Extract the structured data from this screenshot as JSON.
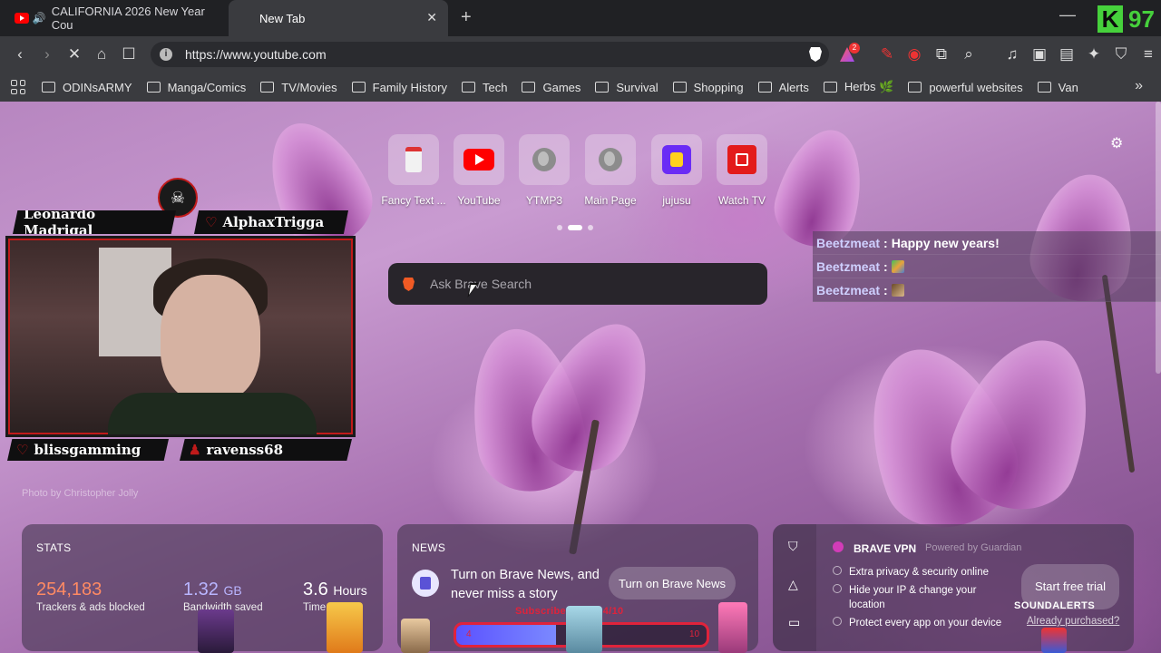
{
  "tabs": [
    {
      "title": "CALIFORNIA 2026 New Year Cou"
    },
    {
      "title": "New Tab"
    }
  ],
  "overlay_logo": {
    "letter": "K",
    "number": "97"
  },
  "address_bar": {
    "url": "https://www.youtube.com",
    "rewards_badge": "2"
  },
  "bookmarks": [
    {
      "label": "ODINsARMY"
    },
    {
      "label": "Manga/Comics"
    },
    {
      "label": "TV/Movies"
    },
    {
      "label": "Family History"
    },
    {
      "label": "Tech"
    },
    {
      "label": "Games"
    },
    {
      "label": "Survival"
    },
    {
      "label": "Shopping"
    },
    {
      "label": "Alerts"
    },
    {
      "label": "Herbs 🌿"
    },
    {
      "label": "powerful websites"
    },
    {
      "label": "Van"
    }
  ],
  "top_sites": [
    {
      "label": "Fancy Text ...",
      "icon": "document-icon"
    },
    {
      "label": "YouTube",
      "icon": "youtube-icon"
    },
    {
      "label": "YTMP3",
      "icon": "globe-icon"
    },
    {
      "label": "Main Page",
      "icon": "globe-icon"
    },
    {
      "label": "jujusu",
      "icon": "jujusu-icon"
    },
    {
      "label": "Watch TV",
      "icon": "tv-icon"
    }
  ],
  "search": {
    "placeholder": "Ask Brave Search"
  },
  "chat": [
    {
      "user": "Beetzmeat",
      "sep": ":",
      "message": "Happy new years!"
    },
    {
      "user": "Beetzmeat",
      "sep": ":",
      "message": ""
    },
    {
      "user": "Beetzmeat",
      "sep": ":",
      "message": ""
    }
  ],
  "stream_overlay": {
    "top_left_name": "Leonardo Madrigal",
    "top_right_name": "AlphaxTrigga",
    "bottom_left_name": "blissgamming",
    "bottom_right_name": "ravenss68",
    "photo_credit": "Photo by Christopher Jolly"
  },
  "stats": {
    "title": "STATS",
    "trackers_value": "254,183",
    "trackers_label": "Trackers & ads blocked",
    "bandwidth_value": "1.32",
    "bandwidth_unit": "GB",
    "bandwidth_label": "Bandwidth saved",
    "time_value": "3.6",
    "time_unit": "Hours",
    "time_label": "Time saved"
  },
  "news": {
    "title": "NEWS",
    "text": "Turn on Brave News, and never miss a story",
    "button": "Turn on Brave News"
  },
  "vpn": {
    "title": "BRAVE VPN",
    "powered_by": "Powered by",
    "powered_brand": "Guardian",
    "items": [
      "Extra privacy & security online",
      "Hide your IP & change your location",
      "Protect every app on your device"
    ],
    "button": "Start free trial",
    "link": "Already purchased?"
  },
  "subscriber_goal": {
    "text": "Subscriber Goal: 4/10",
    "current": "4",
    "target": "10",
    "fraction": 0.4
  },
  "sound_alerts": "SOUNDALERTS",
  "colors": {
    "accent_red": "#e0233b",
    "chat_user": "#cfd0ff",
    "brave_orange": "#f15a24",
    "k97_green": "#46d13c"
  }
}
